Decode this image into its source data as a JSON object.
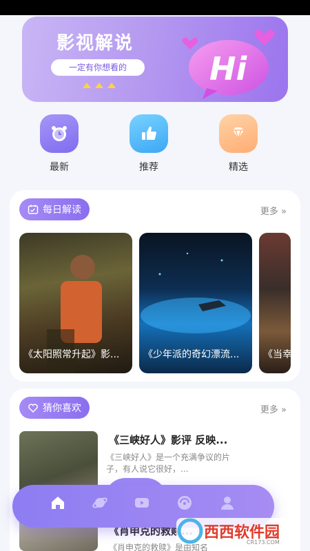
{
  "banner": {
    "title": "影视解说",
    "subtitle": "一定有你想看的"
  },
  "categories": [
    {
      "label": "最新",
      "icon": "alarm-clock-icon",
      "color": "#8c7af0"
    },
    {
      "label": "推荐",
      "icon": "thumbs-up-icon",
      "color": "#4fb3f6"
    },
    {
      "label": "精选",
      "icon": "diamond-icon",
      "color": "#ffb77a"
    }
  ],
  "daily": {
    "title": "每日解读",
    "more": "更多",
    "cards": [
      {
        "title": "《太阳照常升起》影..."
      },
      {
        "title": "《少年派的奇幻漂流..."
      },
      {
        "title": "《当幸"
      }
    ]
  },
  "guess": {
    "title": "猜你喜欢",
    "more": "更多",
    "items": [
      {
        "title": "《三峡好人》影评 反映...",
        "desc": "《三峡好人》是一个充满争议的片子，有人说它很好，..."
      },
      {
        "title": "《肖申克的救赎...",
        "desc": "《肖申克的救赎》是由知名"
      }
    ]
  },
  "bottom_nav": [
    {
      "icon": "home-icon",
      "active": true
    },
    {
      "icon": "planet-icon",
      "active": false
    },
    {
      "icon": "video-icon",
      "active": false
    },
    {
      "icon": "discover-icon",
      "active": false
    },
    {
      "icon": "user-icon",
      "active": false
    }
  ],
  "watermark": {
    "brand": "西西软件园",
    "domain": "CR173.COM"
  }
}
